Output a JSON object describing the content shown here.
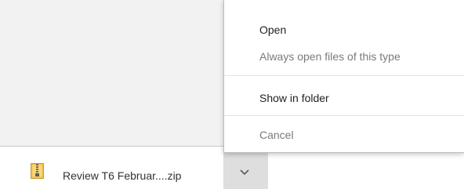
{
  "download_shelf": {
    "file_name": "Review T6  Februar....zip",
    "file_icon": "zip-archive-icon",
    "menu_toggle_icon": "chevron-down-icon"
  },
  "context_menu": {
    "items": [
      {
        "label": "Open",
        "enabled": true
      },
      {
        "label": "Always open files of this type",
        "enabled": false
      },
      {
        "label": "Show in folder",
        "enabled": true
      },
      {
        "label": "Cancel",
        "enabled": false
      }
    ]
  },
  "colors": {
    "page_background": "#f2f2f2",
    "shelf_background": "#ffffff",
    "menu_background": "#ffffff",
    "disabled_text": "#7a7a7a"
  }
}
